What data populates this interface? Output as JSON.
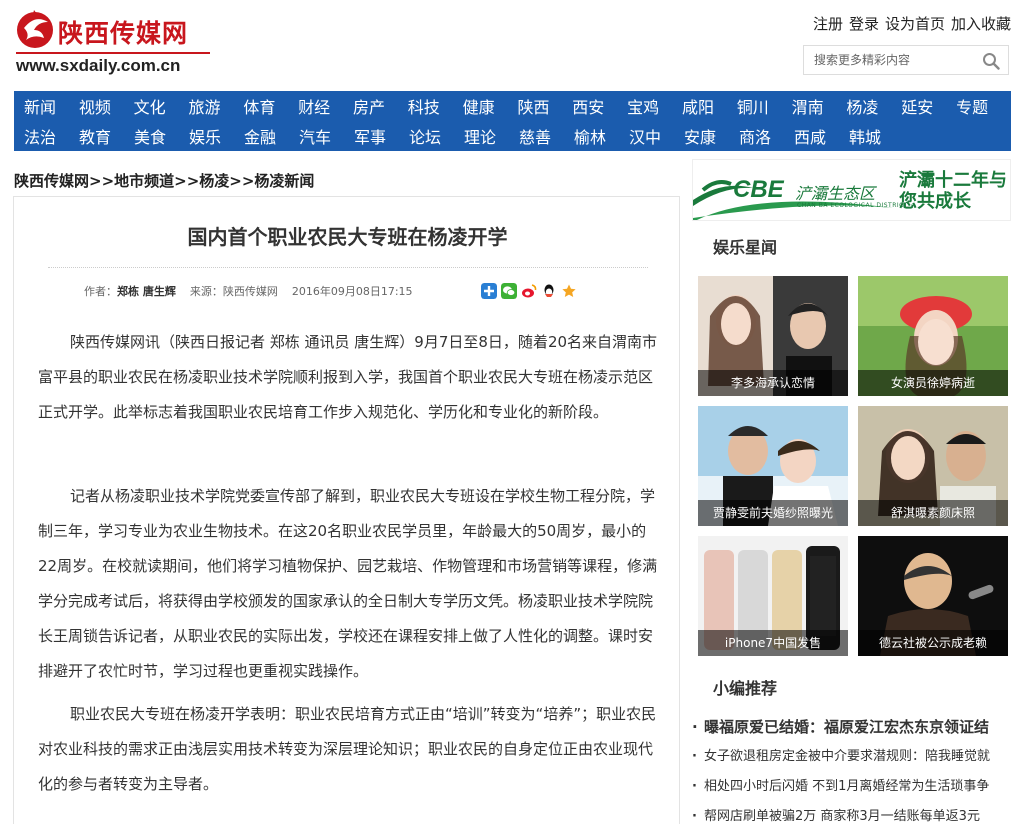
{
  "header": {
    "brand": "陕西传媒网",
    "url": "www.sxdaily.com.cn",
    "links": [
      "注册",
      "登录",
      "设为首页",
      "加入收藏"
    ],
    "search_placeholder": "搜索更多精彩内容"
  },
  "nav": {
    "row1": [
      "新闻",
      "视频",
      "文化",
      "旅游",
      "体育",
      "财经",
      "房产",
      "科技",
      "健康",
      "陕西",
      "西安",
      "宝鸡",
      "咸阳",
      "铜川",
      "渭南",
      "杨凌",
      "延安",
      "专题"
    ],
    "row2": [
      "法治",
      "教育",
      "美食",
      "娱乐",
      "金融",
      "汽车",
      "军事",
      "论坛",
      "理论",
      "慈善",
      "榆林",
      "汉中",
      "安康",
      "商洛",
      "西咸",
      "韩城"
    ]
  },
  "breadcrumb": "陕西传媒网>>地市频道>>杨凌>>杨凌新闻",
  "article": {
    "title": "国内首个职业农民大专班在杨凌开学",
    "author_label": "作者：",
    "author": "郑栋 唐生辉",
    "source": "来源：陕西传媒网",
    "date": "2016年09月08日17:15",
    "paragraphs": [
      "陕西传媒网讯（陕西日报记者 郑栋 通讯员 唐生辉）9月7日至8日，随着20名来自渭南市富平县的职业农民在杨凌职业技术学院顺利报到入学，我国首个职业农民大专班在杨凌示范区正式开学。此举标志着我国职业农民培育工作步入规范化、学历化和专业化的新阶段。",
      "记者从杨凌职业技术学院党委宣传部了解到，职业农民大专班设在学校生物工程分院，学制三年，学习专业为农业生物技术。在这20名职业农民学员里，年龄最大的50周岁，最小的22周岁。在校就读期间，他们将学习植物保护、园艺栽培、作物管理和市场营销等课程，修满学分完成考试后，将获得由学校颁发的国家承认的全日制大专学历文凭。杨凌职业技术学院院长王周锁告诉记者，从职业农民的实际出发，学校还在课程安排上做了人性化的调整。课时安排避开了农忙时节，学习过程也更重视实践操作。",
      "职业农民大专班在杨凌开学表明：职业农民培育方式正由“培训”转变为“培养”；职业农民对农业科技的需求正由浅层实用技术转变为深层理论知识；职业农民的自身定位正由农业现代化的参与者转变为主导者。"
    ]
  },
  "banner": {
    "logo": "CBE",
    "zone": "浐灞生态区",
    "sub": "CHAN BA ECOLOGICAL DISTRICT",
    "slogan": "浐灞十二年与您共成长"
  },
  "ent": {
    "title": "娱乐星闻",
    "items": [
      "李多海承认恋情",
      "女演员徐婷病逝",
      "贾静雯前夫婚纱照曝光",
      "舒淇曝素颜床照",
      "iPhone7中国发售",
      "德云社被公示成老赖"
    ]
  },
  "rec": {
    "title": "小编推荐",
    "items": [
      "曝福原爱已结婚：福原爱江宏杰东京领证结",
      "女子欲退租房定金被中介要求潜规则：陪我睡觉就",
      "相处四小时后闪婚 不到1月离婚经常为生活琐事争",
      "帮网店刷单被骗2万 商家称3月一结账每单返3元"
    ]
  },
  "colors": {
    "brand_red": "#c8161d",
    "nav_blue": "#1b5cae",
    "eco_green": "#1a7a3c"
  }
}
